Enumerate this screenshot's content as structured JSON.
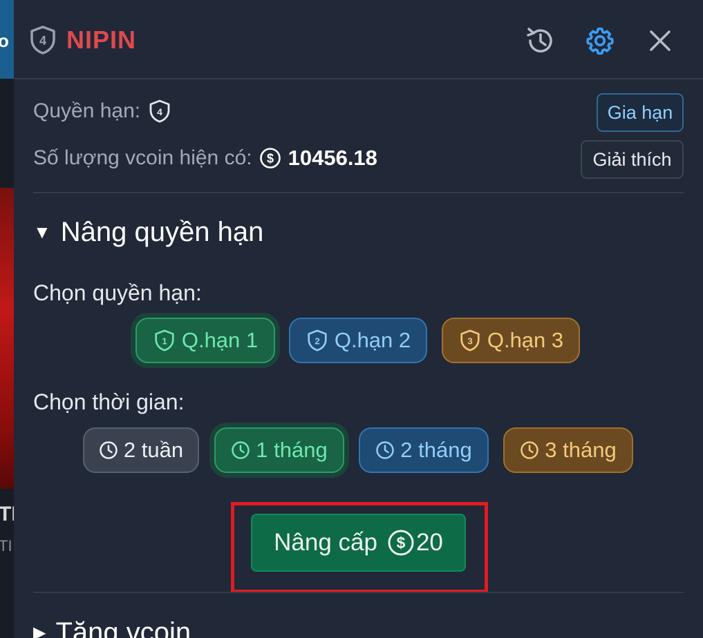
{
  "background": {
    "left_text_top": "o",
    "left_text_mid": "TI",
    "left_text_low": "TI"
  },
  "header": {
    "brand_name": "NIPIN",
    "brand_color": "#e0494d",
    "brand_icon": "shield-4-icon",
    "history_icon": "history-icon",
    "settings_icon": "gear-icon",
    "close_icon": "close-icon"
  },
  "account": {
    "permission_label": "Quyền hạn:",
    "permission_level": "4",
    "vcoin_label": "Số lượng vcoin hiện có:",
    "vcoin_value": "10456.18",
    "renew_button": "Gia hạn",
    "explain_button": "Giải thích"
  },
  "upgrade_section": {
    "title": "Nâng quyền hạn",
    "expanded": true,
    "choose_permission_label": "Chọn quyền hạn:",
    "tiers": [
      {
        "label": "Q.hạn 1",
        "number": "1",
        "color": "#6fe8ad",
        "selected": true
      },
      {
        "label": "Q.hạn 2",
        "number": "2",
        "color": "#93cdfb",
        "selected": false
      },
      {
        "label": "Q.hạn 3",
        "number": "3",
        "color": "#f6c97a",
        "selected": false
      }
    ],
    "choose_time_label": "Chọn thời gian:",
    "durations": [
      {
        "label": "2 tuần",
        "selected": false
      },
      {
        "label": "1 tháng",
        "selected": true
      },
      {
        "label": "2 tháng",
        "selected": false
      },
      {
        "label": "3 tháng",
        "selected": false
      }
    ],
    "upgrade_button": {
      "label": "Nâng cấp",
      "price": "20"
    }
  },
  "gift_section": {
    "title": "Tặng vcoin",
    "expanded": false
  }
}
